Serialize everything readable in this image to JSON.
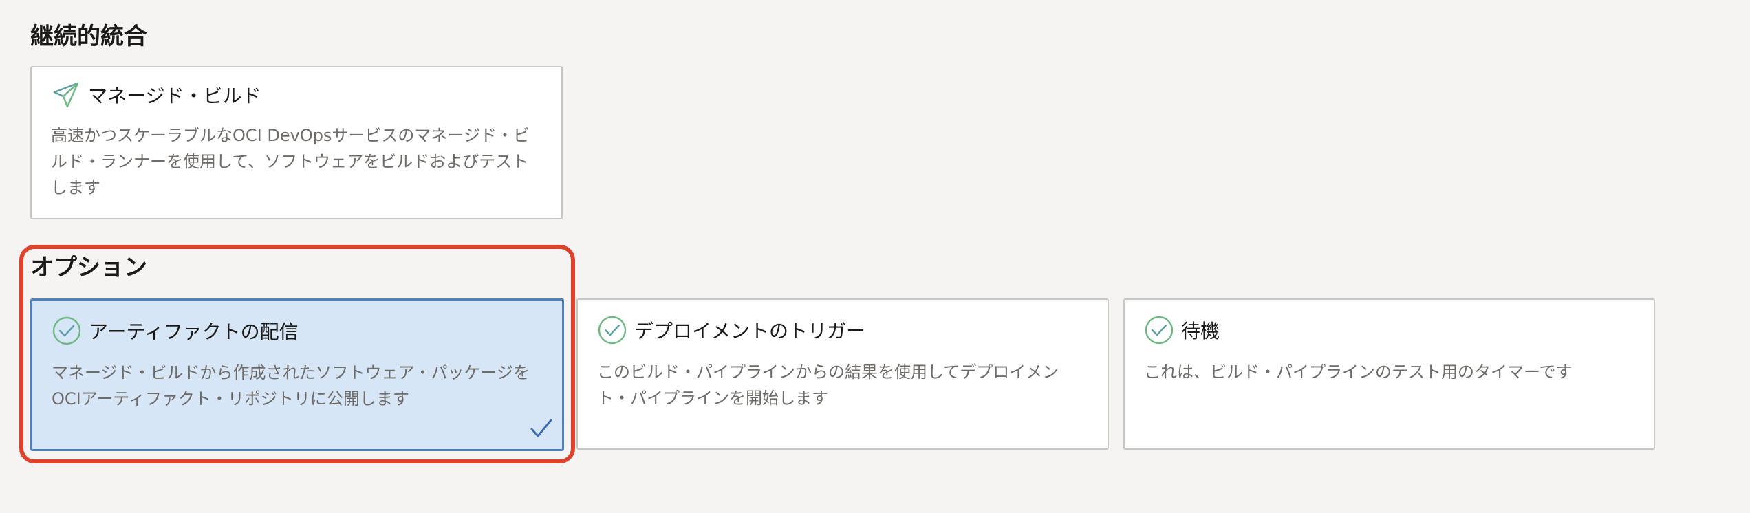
{
  "continuous_integration": {
    "title": "継続的統合",
    "cards": [
      {
        "title": "マネージド・ビルド",
        "icon": "paper-plane-icon",
        "description": "高速かつスケーラブルなOCI DevOpsサービスのマネージド・ビルド・ランナーを使用して、ソフトウェアをビルドおよびテストします"
      }
    ]
  },
  "options": {
    "title": "オプション",
    "cards": [
      {
        "title": "アーティファクトの配信",
        "icon": "check-circle-icon",
        "description": "マネージド・ビルドから作成されたソフトウェア・パッケージをOCIアーティファクト・リポジトリに公開します",
        "selected": true
      },
      {
        "title": "デプロイメントのトリガー",
        "icon": "check-circle-icon",
        "description": "このビルド・パイプラインからの結果を使用してデプロイメント・パイプラインを開始します",
        "selected": false
      },
      {
        "title": "待機",
        "icon": "check-circle-icon",
        "description": "これは、ビルド・パイプラインのテスト用のタイマーです",
        "selected": false
      }
    ]
  },
  "colors": {
    "selected_background": "#d7e6f7",
    "selected_border": "#4d7fc4",
    "highlight": "#e0412a",
    "icon_green": "#6cb982",
    "icon_teal": "#5d9fa8"
  }
}
